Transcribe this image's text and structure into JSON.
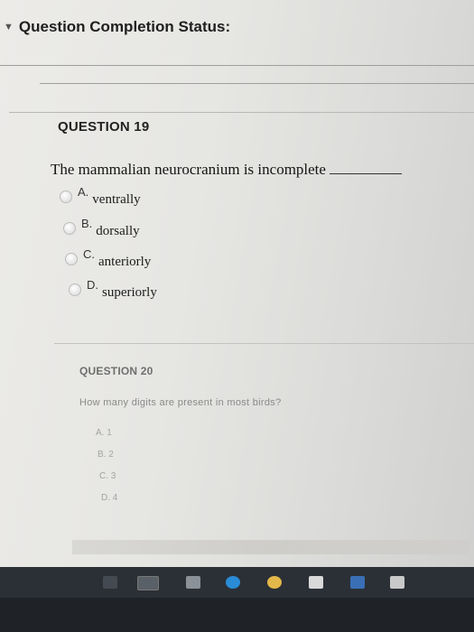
{
  "header": {
    "title": "Question Completion Status:",
    "icon": "chevron-down-icon"
  },
  "question19": {
    "title": "QUESTION 19",
    "text": "The mammalian neurocranium is incomplete",
    "options": [
      {
        "letter": "A.",
        "text": "ventrally"
      },
      {
        "letter": "B.",
        "text": "dorsally"
      },
      {
        "letter": "C.",
        "text": "anteriorly"
      },
      {
        "letter": "D.",
        "text": "superiorly"
      }
    ]
  },
  "question20": {
    "title": "QUESTION 20",
    "text": "How many digits are present in most birds?",
    "options": [
      {
        "letter": "A.",
        "text": "1"
      },
      {
        "letter": "B.",
        "text": "2"
      },
      {
        "letter": "C.",
        "text": "3"
      },
      {
        "letter": "D.",
        "text": "4"
      }
    ]
  },
  "taskbar": {
    "icons": [
      "task-view-icon",
      "file-explorer-icon",
      "edge-icon",
      "chrome-icon",
      "store-icon",
      "app-icon",
      "mail-icon"
    ],
    "colors": {
      "bar": "#1f2328",
      "edge": "#2a8bd6",
      "chrome": "#e3b84a",
      "store": "#3a6fb5"
    }
  }
}
